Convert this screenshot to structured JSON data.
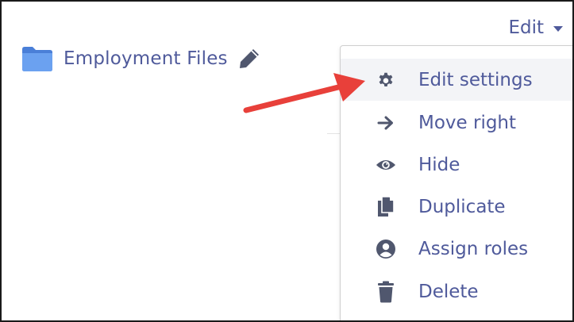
{
  "folder": {
    "name": "Employment Files",
    "icon": "folder-icon",
    "edit_icon": "pencil-icon"
  },
  "edit_menu": {
    "trigger_label": "Edit",
    "items": [
      {
        "label": "Edit settings",
        "icon": "gear-icon",
        "active": true
      },
      {
        "label": "Move right",
        "icon": "arrow-right-icon"
      },
      {
        "label": "Hide",
        "icon": "eye-icon"
      },
      {
        "label": "Duplicate",
        "icon": "copy-icon"
      },
      {
        "label": "Assign roles",
        "icon": "user-circle-icon"
      },
      {
        "label": "Delete",
        "icon": "trash-icon"
      }
    ]
  },
  "background": {
    "clipped_text": "y"
  },
  "colors": {
    "link_text": "#4f5a9b",
    "icon": "#50576e",
    "folder": "#5b8fe6",
    "annotation_arrow": "#e8403a",
    "active_item_bg": "#f3f4f7"
  }
}
